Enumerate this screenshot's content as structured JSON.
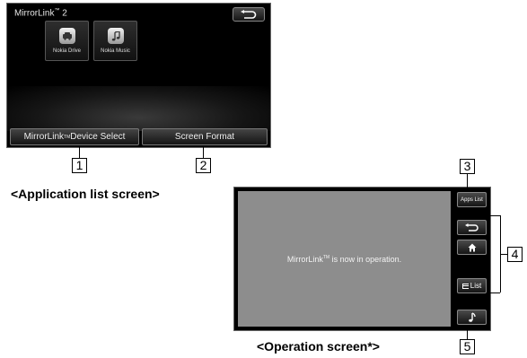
{
  "application_list_screen": {
    "title": "MirrorLink",
    "title_tm": "™",
    "title_version": " 2",
    "back_icon": "back-arrow-icon",
    "apps": [
      {
        "label": "Nokia Drive",
        "icon": "car-icon"
      },
      {
        "label": "Nokia Music",
        "icon": "music-note-icon"
      }
    ],
    "device_select_button": {
      "prefix": "MirrorLink",
      "tm": "TM",
      "suffix": " Device Select"
    },
    "screen_format_button": "Screen Format",
    "caption": "<Application list screen>"
  },
  "operation_screen": {
    "message_prefix": "MirrorLink",
    "message_tm": "TM",
    "message_suffix": " is now in operation.",
    "apps_list_button": "Apps List",
    "back_icon": "back-arrow-icon",
    "home_icon": "home-icon",
    "list_button": "List",
    "music_icon": "music-note-icon",
    "caption": "<Operation screen*>"
  },
  "callouts": [
    "1",
    "2",
    "3",
    "4",
    "5"
  ]
}
